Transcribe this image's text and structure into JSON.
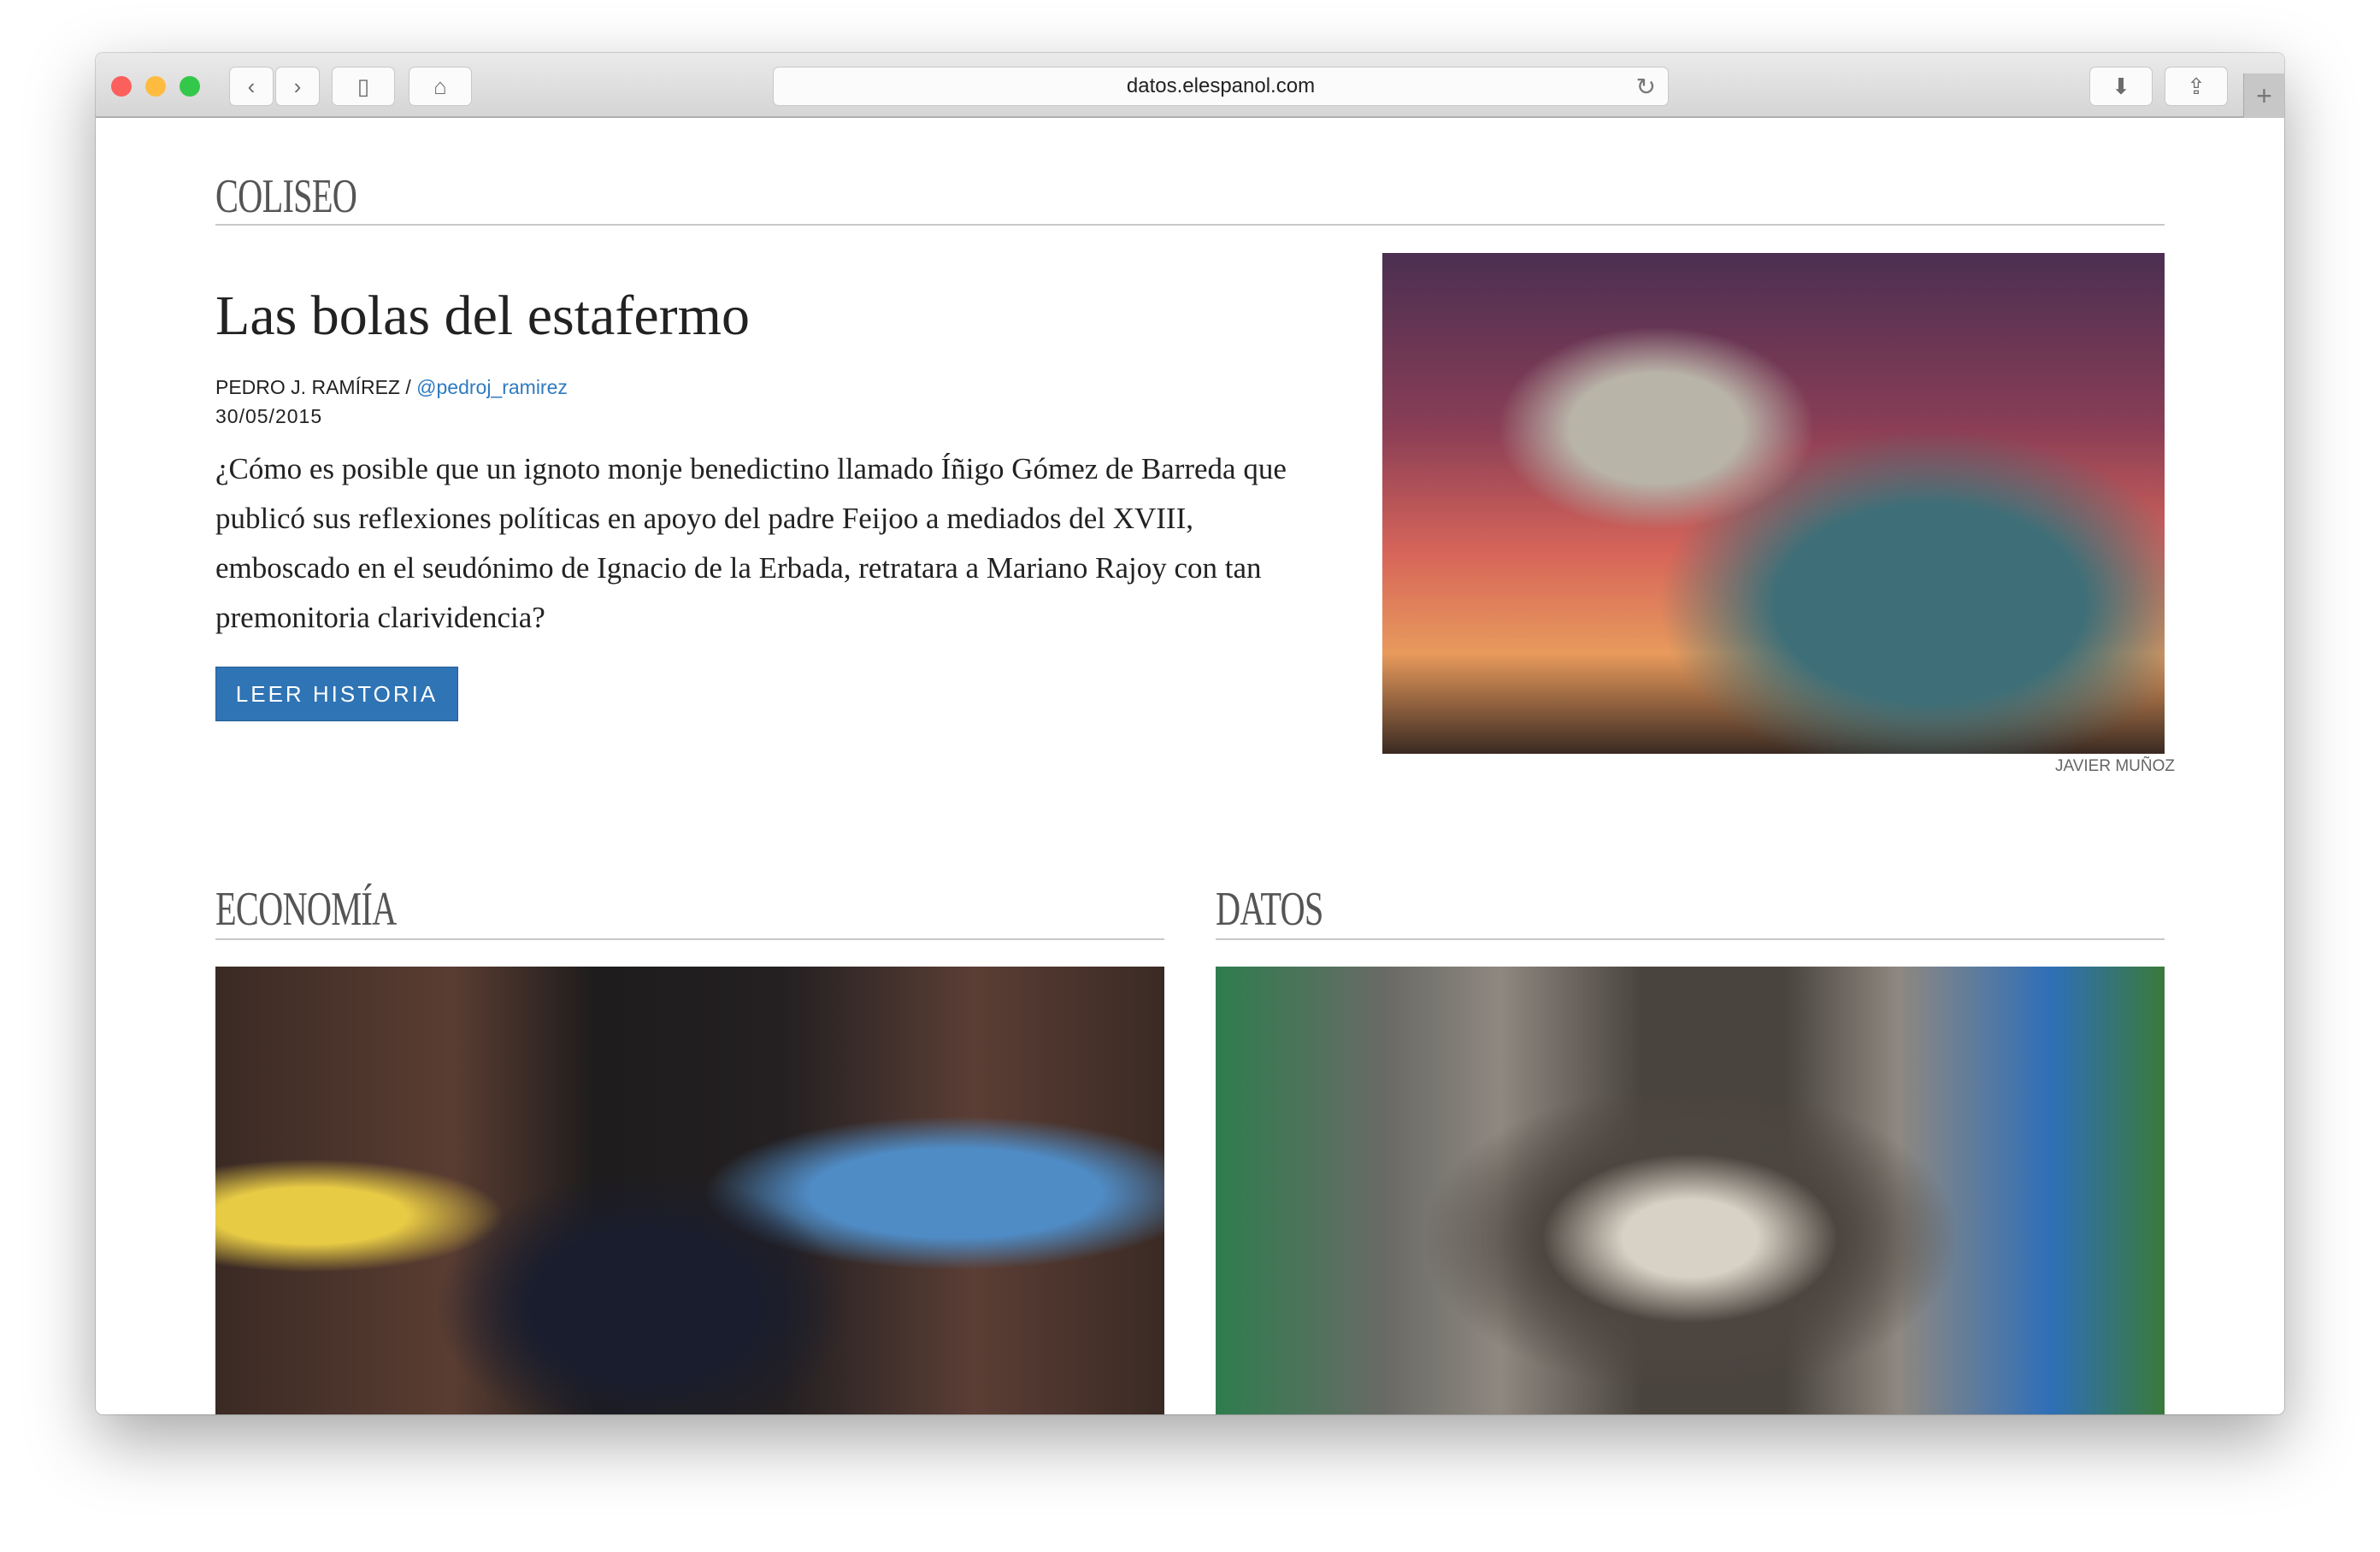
{
  "browser": {
    "url": "datos.elespanol.com",
    "colors": {
      "close": "#fc605c",
      "minimize": "#fdbc40",
      "zoom": "#34c84a"
    }
  },
  "coliseo": {
    "section": "COLISEO",
    "title": "Las bolas del estafermo",
    "author": "PEDRO J. RAMÍREZ",
    "separator": " / ",
    "handle": "@pedroj_ramirez",
    "date": "30/05/2015",
    "lede": "¿Cómo es posible que un ignoto monje benedictino llamado Íñigo Gómez de Barreda que publicó sus reflexiones políticas en apoyo del padre Feijoo a mediados del XVIII, emboscado en el seudónimo de Ignacio de la Erbada, retratara a Mariano Rajoy con tan premonitoria clarividencia?",
    "button": "LEER HISTORIA",
    "photo_credit": "JAVIER MUÑOZ"
  },
  "economia": {
    "section": "ECONOMÍA"
  },
  "datos": {
    "section": "DATOS"
  }
}
